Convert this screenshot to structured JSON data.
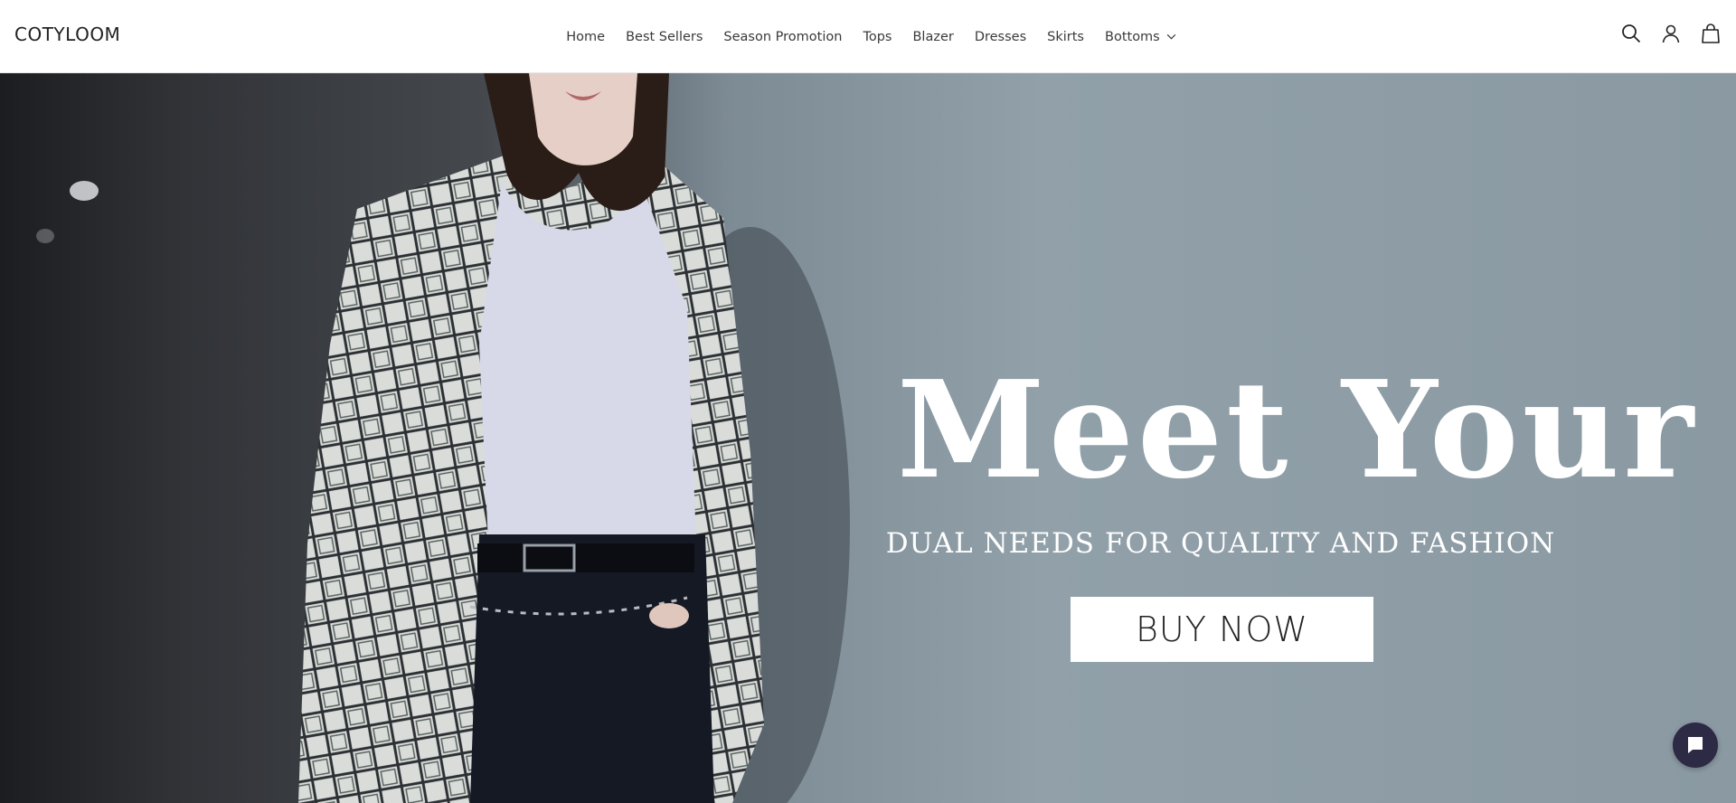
{
  "brand": {
    "logo_text": "COTYLOOM"
  },
  "nav": {
    "items": [
      {
        "label": "Home"
      },
      {
        "label": "Best Sellers"
      },
      {
        "label": "Season Promotion"
      },
      {
        "label": "Tops"
      },
      {
        "label": "Blazer"
      },
      {
        "label": "Dresses"
      },
      {
        "label": "Skirts"
      },
      {
        "label": "Bottoms",
        "icon": "chevron-down-icon"
      }
    ]
  },
  "header_icons": [
    "search-icon",
    "account-icon",
    "bag-icon"
  ],
  "hero": {
    "headline": "Meet Your",
    "subheadline": "DUAL NEEDS FOR QUALITY AND FASHION",
    "cta_label": "BUY NOW"
  },
  "chat_widget": {
    "icon": "chat-bubble-icon"
  },
  "colors": {
    "header_bg": "#ffffff",
    "text": "#222222",
    "hero_bg": "#8d9aa3",
    "cta_bg": "#ffffff",
    "chat_bg": "#2c2a44"
  }
}
